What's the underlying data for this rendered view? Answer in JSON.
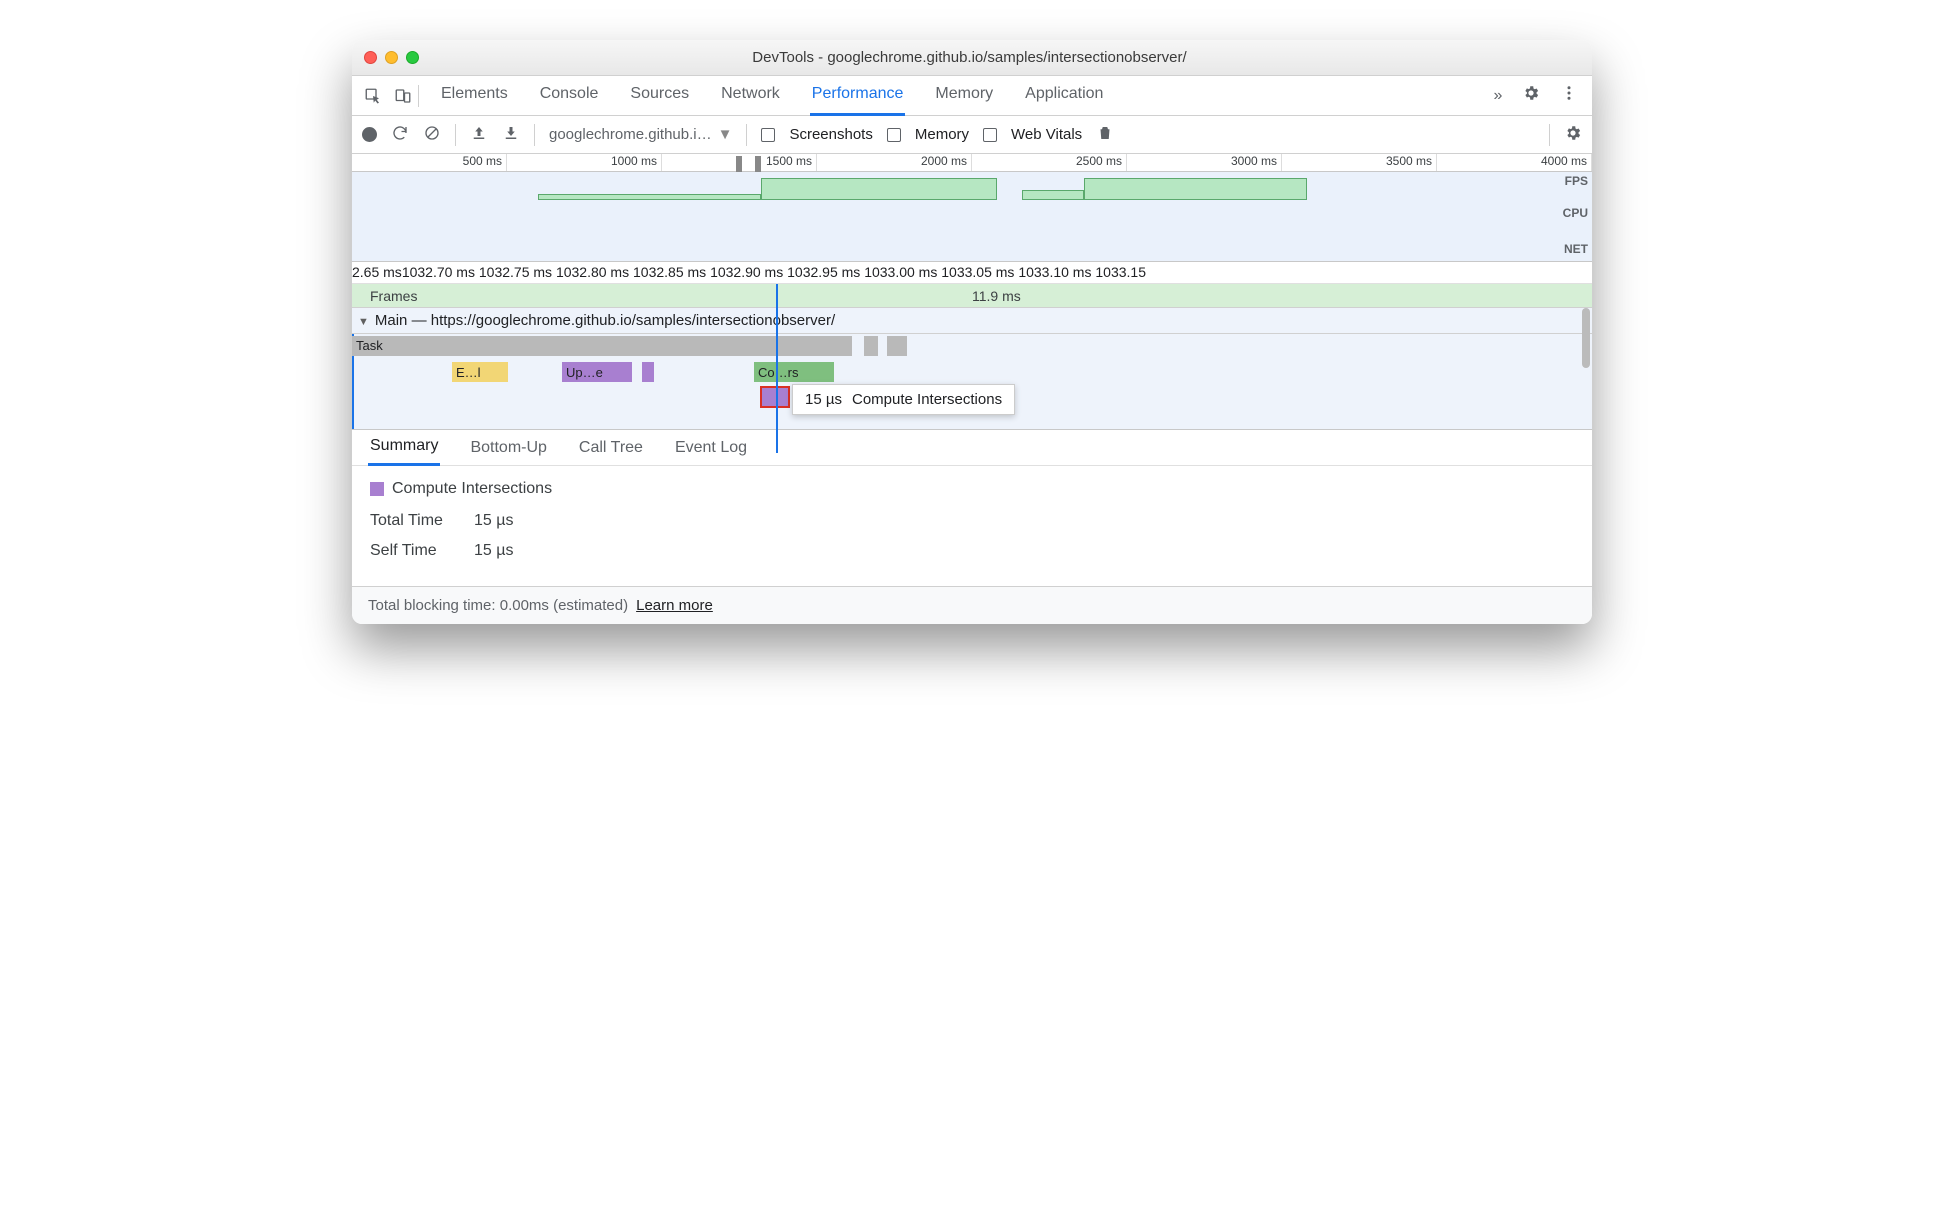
{
  "window": {
    "title": "DevTools - googlechrome.github.io/samples/intersectionobserver/"
  },
  "tabs": {
    "items": [
      "Elements",
      "Console",
      "Sources",
      "Network",
      "Performance",
      "Memory",
      "Application"
    ],
    "active": "Performance"
  },
  "toolbar": {
    "page_select": "googlechrome.github.i…",
    "checks": {
      "screenshots": "Screenshots",
      "memory": "Memory",
      "webvitals": "Web Vitals"
    }
  },
  "overview": {
    "ticks": [
      "500 ms",
      "1000 ms",
      "1500 ms",
      "2000 ms",
      "2500 ms",
      "3000 ms",
      "3500 ms",
      "4000 ms"
    ],
    "labels": {
      "fps": "FPS",
      "cpu": "CPU",
      "net": "NET"
    }
  },
  "ruler": [
    "2.65 ms",
    "1032.70 ms",
    "1032.75 ms",
    "1032.80 ms",
    "1032.85 ms",
    "1032.90 ms",
    "1032.95 ms",
    "1033.00 ms",
    "1033.05 ms",
    "1033.10 ms",
    "1033.15"
  ],
  "frames": {
    "label": "Frames",
    "value": "11.9 ms"
  },
  "main": {
    "label": "Main — https://googlechrome.github.io/samples/intersectionobserver/"
  },
  "flame": {
    "task": "Task",
    "blocks": {
      "el": "E…l",
      "upe": "Up…e",
      "cors": "Co…rs"
    },
    "tooltip": {
      "time": "15 µs",
      "name": "Compute Intersections"
    }
  },
  "detail_tabs": {
    "items": [
      "Summary",
      "Bottom-Up",
      "Call Tree",
      "Event Log"
    ],
    "active": "Summary"
  },
  "summary": {
    "title": "Compute Intersections",
    "rows": [
      {
        "k": "Total Time",
        "v": "15 µs"
      },
      {
        "k": "Self Time",
        "v": "15 µs"
      }
    ]
  },
  "footer": {
    "text": "Total blocking time: 0.00ms (estimated)",
    "link": "Learn more"
  }
}
